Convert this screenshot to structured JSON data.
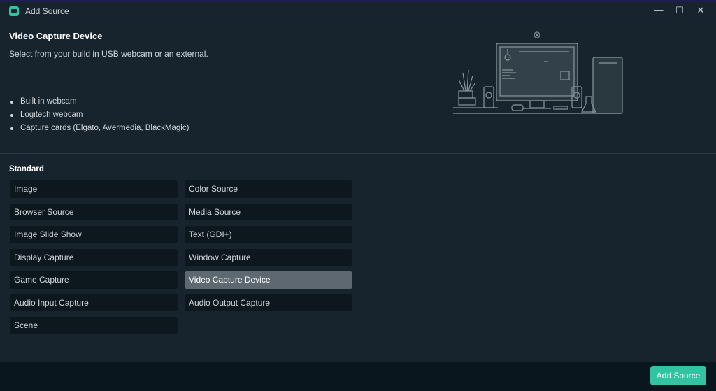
{
  "window": {
    "title": "Add Source",
    "controls": {
      "minimize": "—",
      "maximize": "☐",
      "close": "✕"
    }
  },
  "header": {
    "title": "Video Capture Device",
    "description": "Select from your build in USB webcam or an external.",
    "features": [
      "Built in webcam",
      "Logitech webcam",
      "Capture cards (Elgato, Avermedia, BlackMagic)"
    ]
  },
  "standard": {
    "label": "Standard",
    "column1": [
      "Image",
      "Browser Source",
      "Image Slide Show",
      "Display Capture",
      "Game Capture",
      "Audio Input Capture",
      "Scene"
    ],
    "column2": [
      "Color Source",
      "Media Source",
      "Text (GDI+)",
      "Window Capture",
      "Video Capture Device",
      "Audio Output Capture"
    ],
    "selected": "Video Capture Device"
  },
  "footer": {
    "add_label": "Add Source"
  },
  "colors": {
    "accent": "#31c3a2",
    "background": "#17242d",
    "item": "#0d171e",
    "selected": "#5d6870"
  }
}
